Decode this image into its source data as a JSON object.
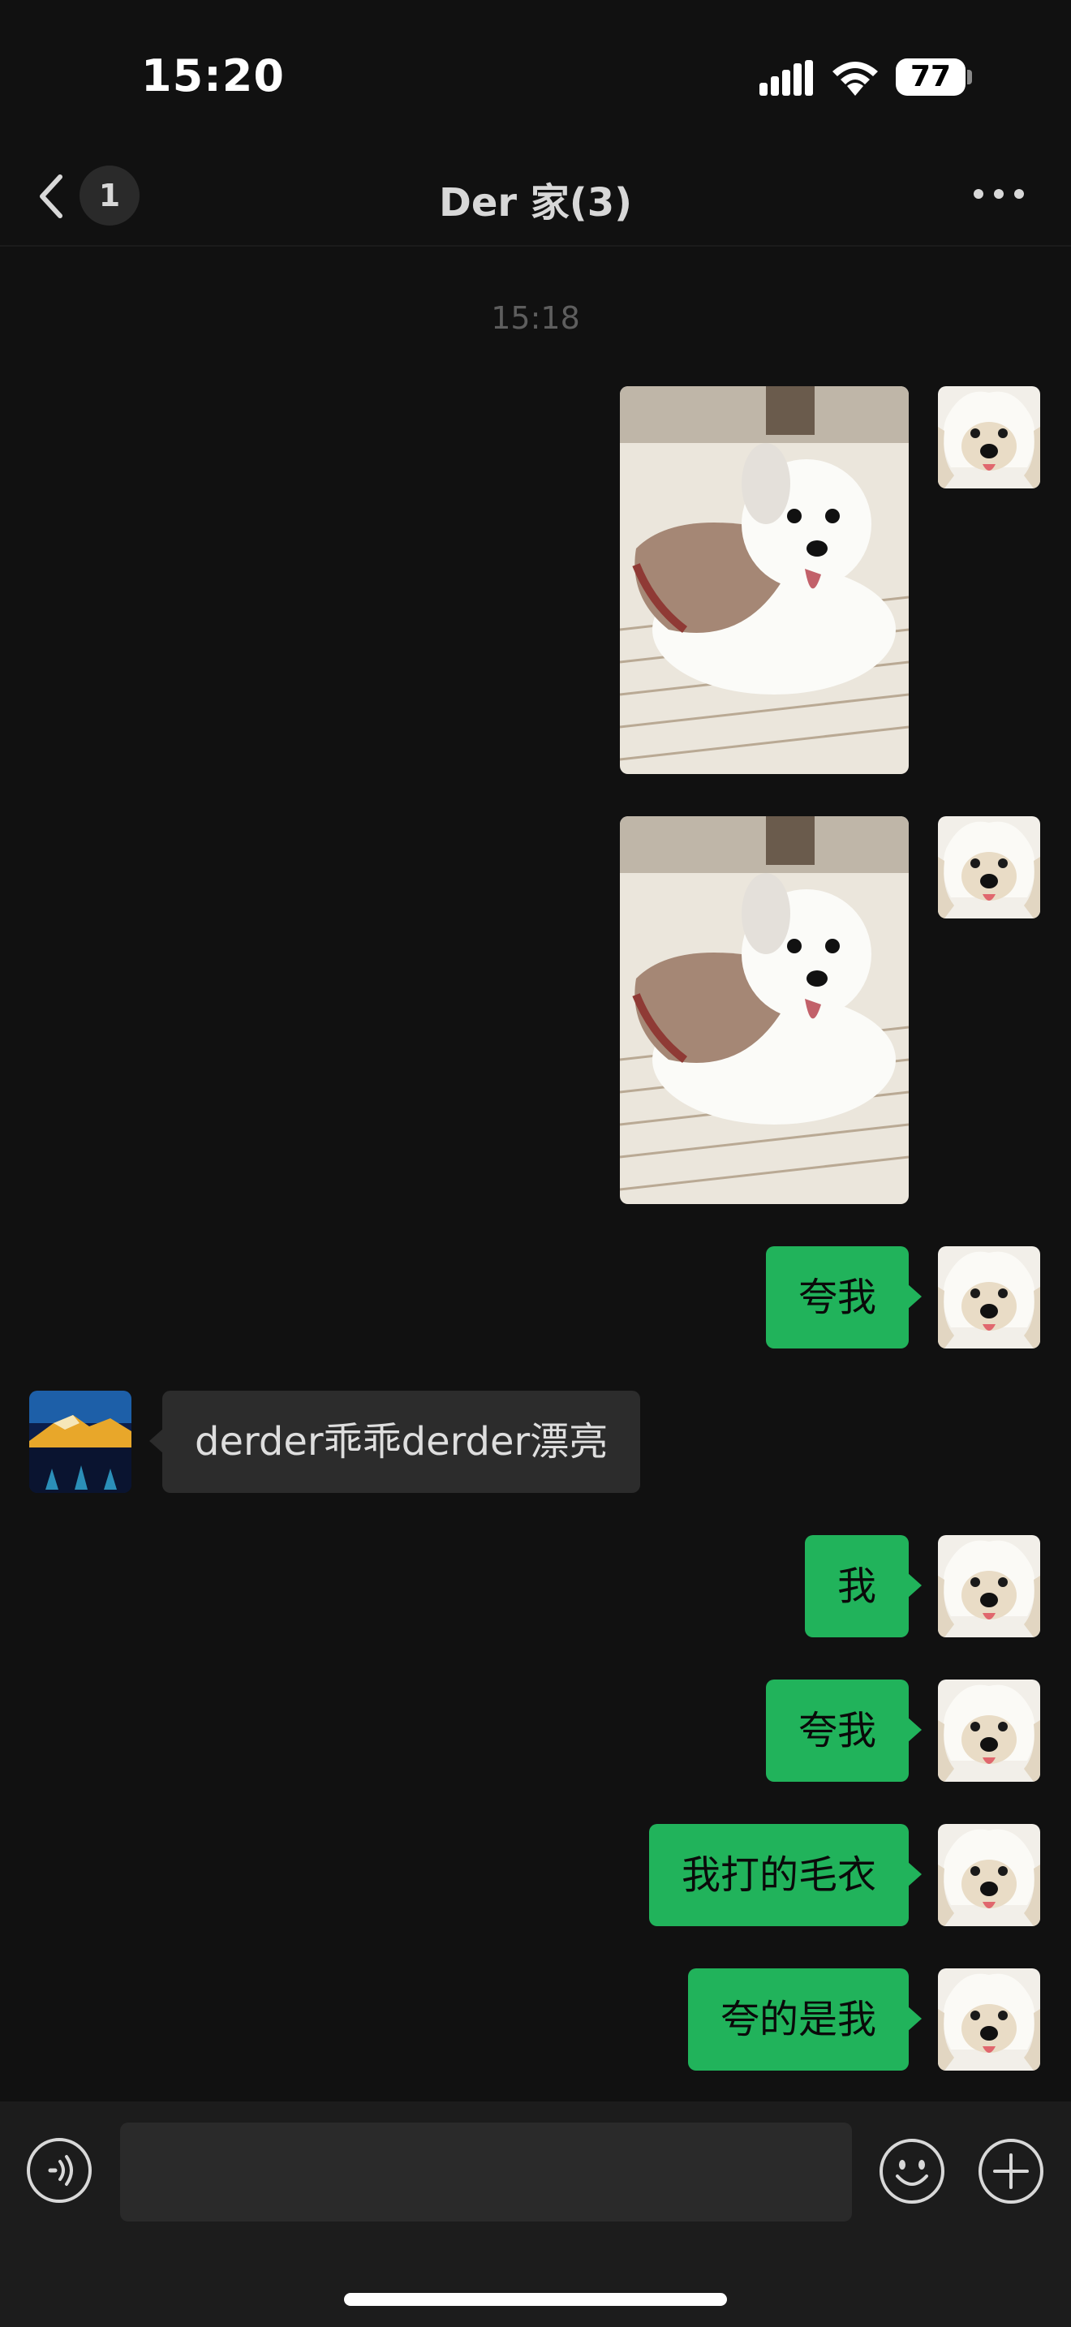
{
  "status_bar": {
    "time": "15:20",
    "battery": "77",
    "icons": [
      "signal-icon",
      "wifi-icon",
      "battery-icon"
    ]
  },
  "nav": {
    "unread_count": "1",
    "title": "Der 家(3)",
    "icons": [
      "back-icon",
      "more-icon"
    ]
  },
  "chat": {
    "timestamp": "15:18",
    "messages": [
      {
        "sender": "me",
        "type": "image",
        "content": "dog-in-sweater-photo"
      },
      {
        "sender": "me",
        "type": "image",
        "content": "dog-in-sweater-photo"
      },
      {
        "sender": "me",
        "type": "text",
        "text": "夸我"
      },
      {
        "sender": "other",
        "type": "text",
        "text": "derder乖乖derder漂亮"
      },
      {
        "sender": "me",
        "type": "text",
        "text": "我"
      },
      {
        "sender": "me",
        "type": "text",
        "text": "夸我"
      },
      {
        "sender": "me",
        "type": "text",
        "text": "我打的毛衣"
      },
      {
        "sender": "me",
        "type": "text",
        "text": "夸的是我"
      }
    ]
  },
  "input_bar": {
    "value": "",
    "placeholder": "",
    "icons": [
      "voice-icon",
      "emoji-icon",
      "plus-icon"
    ]
  },
  "colors": {
    "background": "#111111",
    "my_bubble": "#21b35b",
    "other_bubble": "#2c2c2c",
    "input_bar": "#1c1c1c"
  }
}
